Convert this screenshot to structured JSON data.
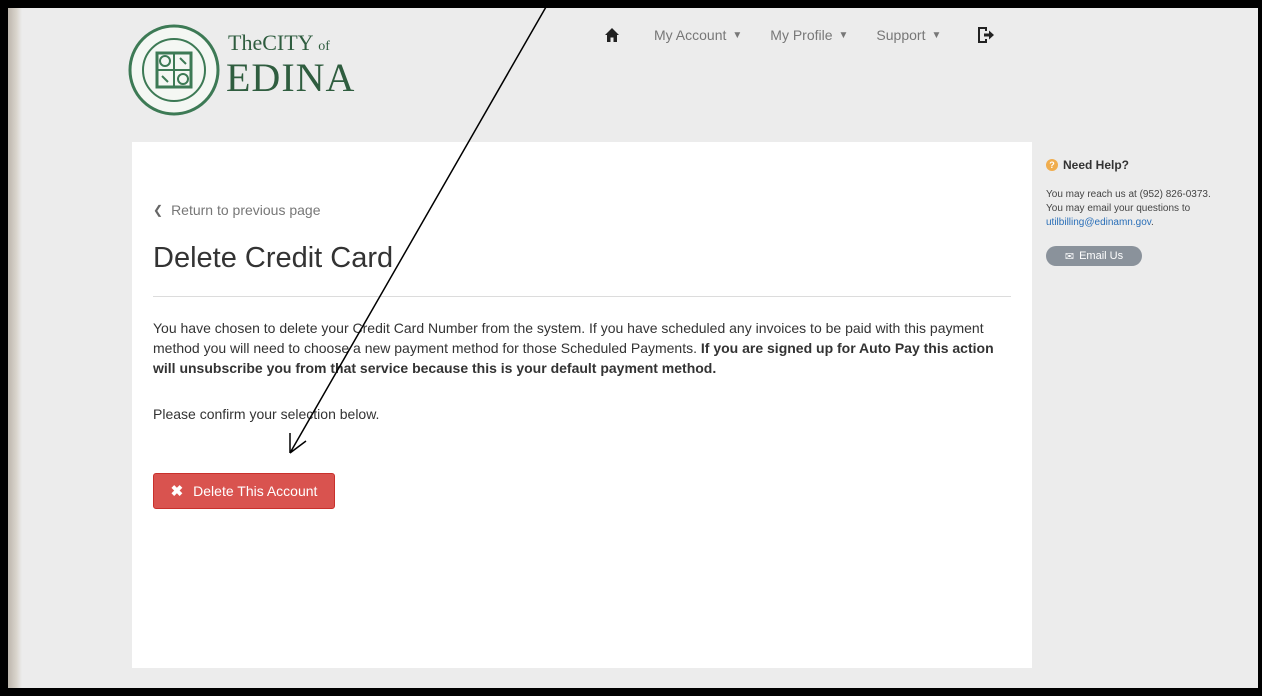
{
  "logo": {
    "the": "The",
    "city": "CITY",
    "of": "of",
    "name": "EDINA"
  },
  "nav": {
    "items": [
      {
        "label": "My Account"
      },
      {
        "label": "My Profile"
      },
      {
        "label": "Support"
      }
    ],
    "home_icon": "home-icon",
    "logout_icon": "logout-icon"
  },
  "main": {
    "back_link": "Return to previous page",
    "title": "Delete Credit Card",
    "message_plain": "You have chosen to delete your Credit Card Number from the system. If you have scheduled any invoices to be paid with this payment method you will need to choose a new payment method for those Scheduled Payments.",
    "message_bold": "If you are signed up for Auto Pay this action will unsubscribe you from that service because this is your default payment method.",
    "confirm": "Please confirm your selection below.",
    "delete_button": "Delete This Account"
  },
  "help": {
    "title": "Need Help?",
    "line1": "You may reach us at (952) 826-0373.",
    "line2": "You may email your questions to",
    "email": "utilbilling@edinamn.gov",
    "email_suffix": ".",
    "email_button": "Email Us"
  },
  "colors": {
    "danger": "#d9534f",
    "brand_green": "#2f5d3f",
    "page_bg": "#ececec",
    "link": "#2a6fb8"
  }
}
